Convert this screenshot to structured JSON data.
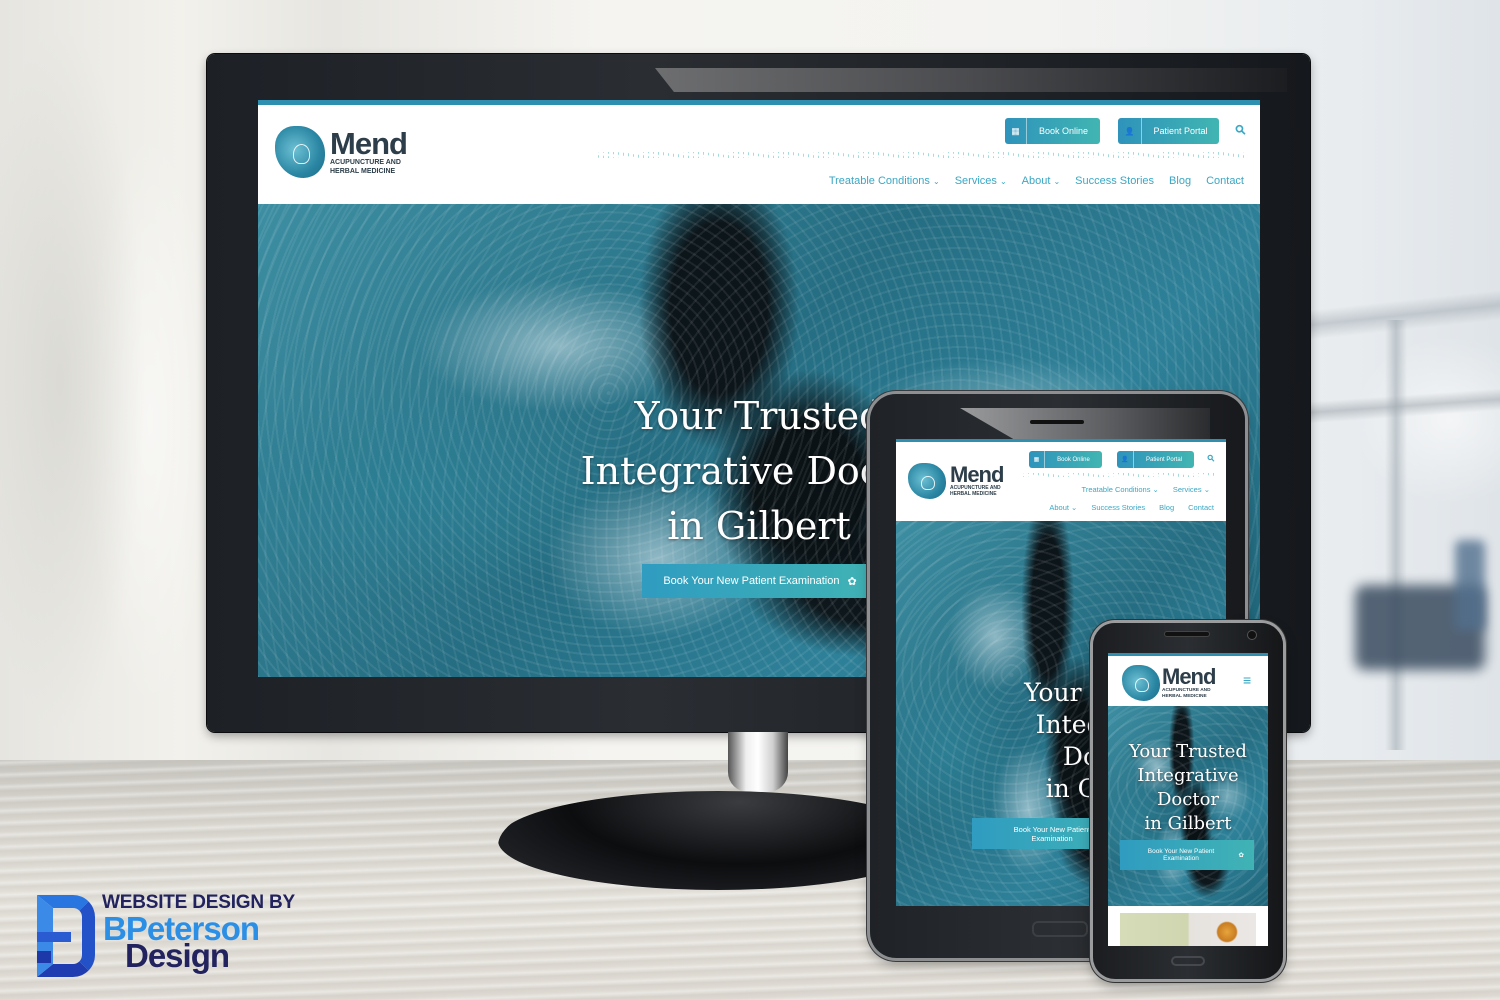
{
  "site": {
    "brand": {
      "name": "Mend",
      "tagline_line1": "ACUPUNCTURE AND",
      "tagline_line2": "HERBAL MEDICINE"
    },
    "header_buttons": [
      {
        "label": "Book Online",
        "icon": "calendar-icon"
      },
      {
        "label": "Patient Portal",
        "icon": "user-lock-icon"
      }
    ],
    "search_icon": "search-icon",
    "nav": [
      {
        "label": "Treatable Conditions",
        "dropdown": true
      },
      {
        "label": "Services",
        "dropdown": true
      },
      {
        "label": "About",
        "dropdown": true
      },
      {
        "label": "Success Stories",
        "dropdown": false
      },
      {
        "label": "Blog",
        "dropdown": false
      },
      {
        "label": "Contact",
        "dropdown": false
      }
    ],
    "hero": {
      "title_desktop": [
        "Your Trusted",
        "Integrative Doctor",
        "in Gilbert"
      ],
      "title_tablet": [
        "Your Trusted",
        "Integrative",
        "Doctor",
        "in Gilbert"
      ],
      "title_phone": [
        "Your Trusted",
        "Integrative",
        "Doctor",
        "in Gilbert"
      ],
      "cta_label": "Book Your New Patient Examination",
      "cta_icon": "lotus-icon"
    },
    "mobile_menu_icon": "hamburger-menu-icon"
  },
  "colors": {
    "accent": "#3aa7c4",
    "button_gradient_start": "#2f93bb",
    "button_gradient_end": "#41b5b2",
    "logo_text": "#2d3e4a",
    "badge_navy": "#22235e",
    "badge_blue": "#2c8fe6"
  },
  "credit": {
    "line1": "WEBSITE DESIGN BY",
    "line2": "BPeterson",
    "line3": "Design",
    "icon": "b-logo-icon"
  },
  "glyphs": {
    "chevron": "⌄",
    "search": "⚲",
    "calendar": "▦",
    "user": "👤",
    "lotus": "✿",
    "hamburger": "≡"
  }
}
